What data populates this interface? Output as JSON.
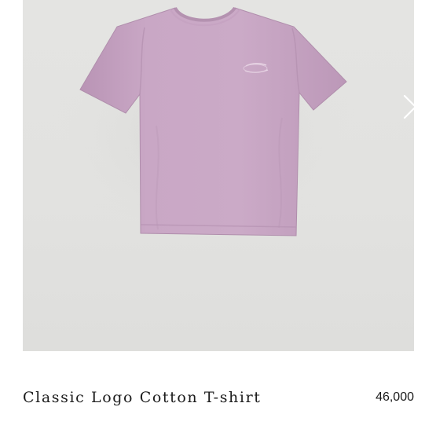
{
  "product": {
    "name": "Classic Logo Cotton T-shirt",
    "price": "46,000",
    "image": {
      "subject": "lavender cotton t-shirt",
      "shirt_color": "#c8a6c4",
      "background_color": "#e3e3e1"
    },
    "gallery": {
      "next_icon": "chevron-right-icon"
    }
  }
}
